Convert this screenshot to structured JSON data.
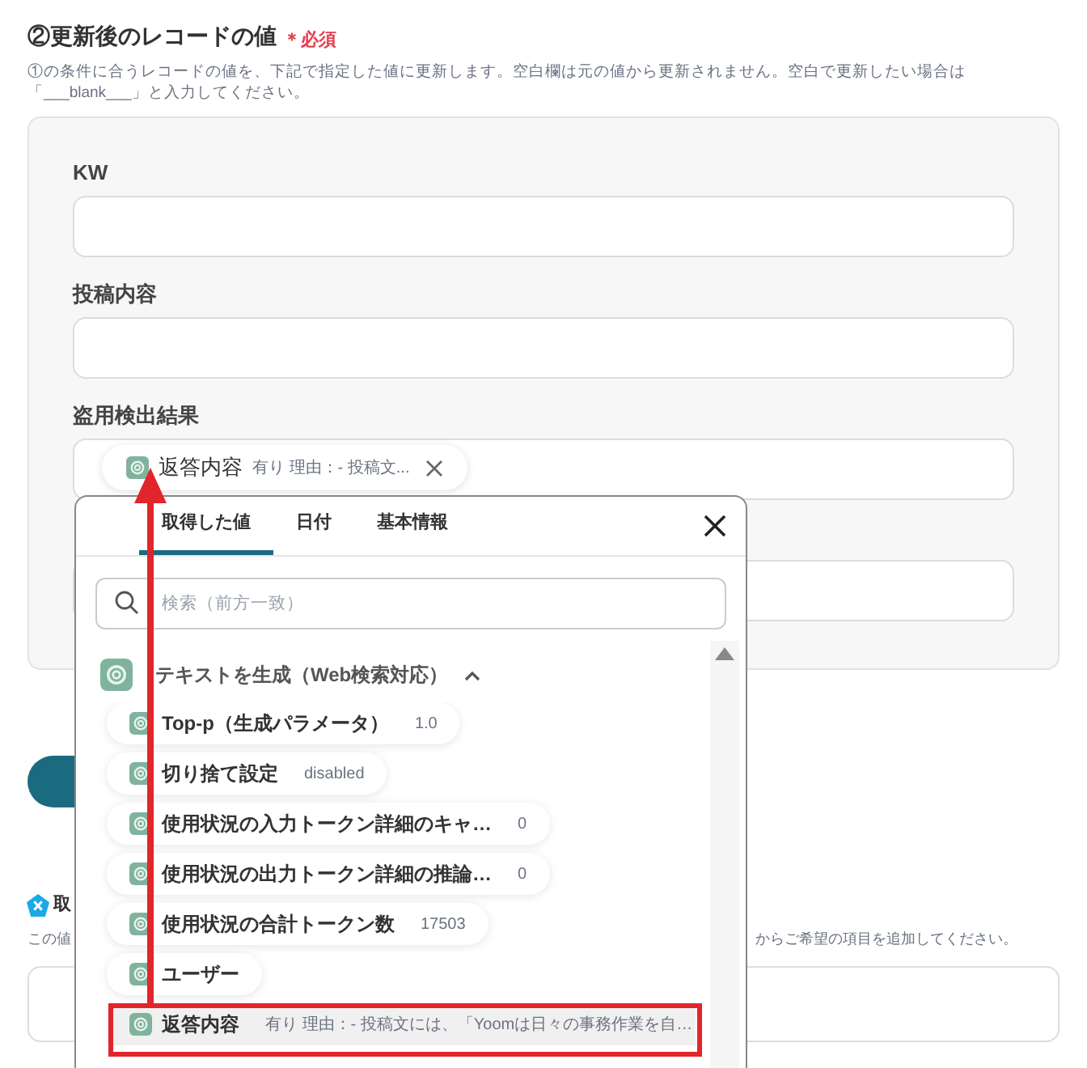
{
  "section": {
    "title": "②更新後のレコードの値",
    "required": "＊必須",
    "description": "①の条件に合うレコードの値を、下記で指定した値に更新します。空白欄は元の値から更新されません。空白で更新したい場合は「___blank___」と入力してください。"
  },
  "fields": [
    {
      "kind": "labeled",
      "label": "KW"
    },
    {
      "kind": "labeled",
      "label": "投稿内容"
    },
    {
      "kind": "labeled",
      "label": "盗用検出結果",
      "chip": {
        "name": "返答内容",
        "value": "有り 理由：- 投稿文..."
      }
    },
    {
      "kind": "unlabeled"
    }
  ],
  "next_section": {
    "title": "取",
    "description_start": "この値",
    "description_end": "からご希望の項目を追加してください。"
  },
  "popup": {
    "tabs": [
      {
        "label": "取得した値",
        "selected": true
      },
      {
        "label": "日付",
        "selected": false
      },
      {
        "label": "基本情報",
        "selected": false
      }
    ],
    "search": {
      "placeholder": "検索（前方一致）"
    },
    "group": {
      "title": "テキストを生成（Web検索対応）",
      "expanded": true
    },
    "items": [
      {
        "name": "Top-p（生成パラメータ）",
        "value": "1.0",
        "selected": false
      },
      {
        "name": "切り捨て設定",
        "value": "disabled",
        "selected": false
      },
      {
        "name": "使用状況の入力トークン詳細のキャ…",
        "value": "0",
        "selected": false
      },
      {
        "name": "使用状況の出力トークン詳細の推論…",
        "value": "0",
        "selected": false
      },
      {
        "name": "使用状況の合計トークン数",
        "value": "17503",
        "selected": false
      },
      {
        "name": "ユーザー",
        "selected": false
      },
      {
        "name": "返答内容",
        "value": "有り 理由：- 投稿文には、「Yoomは日々の事務作業を自…",
        "selected": true
      }
    ]
  }
}
